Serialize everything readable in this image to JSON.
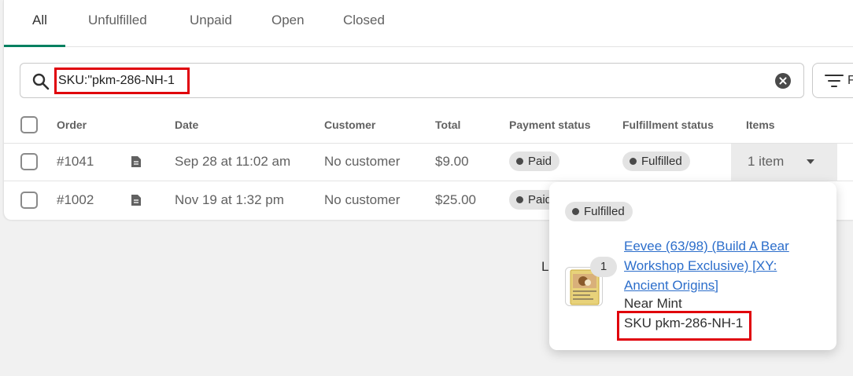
{
  "tabs": [
    "All",
    "Unfulfilled",
    "Unpaid",
    "Open",
    "Closed"
  ],
  "search": {
    "value": "SKU:\"pkm-286-NH-1"
  },
  "filter_button": {
    "label": "F"
  },
  "table": {
    "headers": [
      "Order",
      "Date",
      "Customer",
      "Total",
      "Payment status",
      "Fulfillment status",
      "Items"
    ],
    "rows": [
      {
        "order": "#1041",
        "date": "Sep 28 at 11:02 am",
        "customer": "No customer",
        "total": "$9.00",
        "payment": "Paid",
        "fulfillment": "Fulfilled",
        "items": "1 item"
      },
      {
        "order": "#1002",
        "date": "Nov 19 at 1:32 pm",
        "customer": "No customer",
        "total": "$25.00",
        "payment": "Paid"
      }
    ]
  },
  "partial_text": "L",
  "popover": {
    "status": "Fulfilled",
    "quantity": "1",
    "product_title": "Eevee (63/98) (Build A Bear Workshop Exclusive) [XY: Ancient Origins]",
    "variant": "Near Mint",
    "sku": "SKU pkm-286-NH-1"
  },
  "colors": {
    "accent": "#008060",
    "link": "#2c6ecb",
    "highlight": "#e0000b"
  }
}
